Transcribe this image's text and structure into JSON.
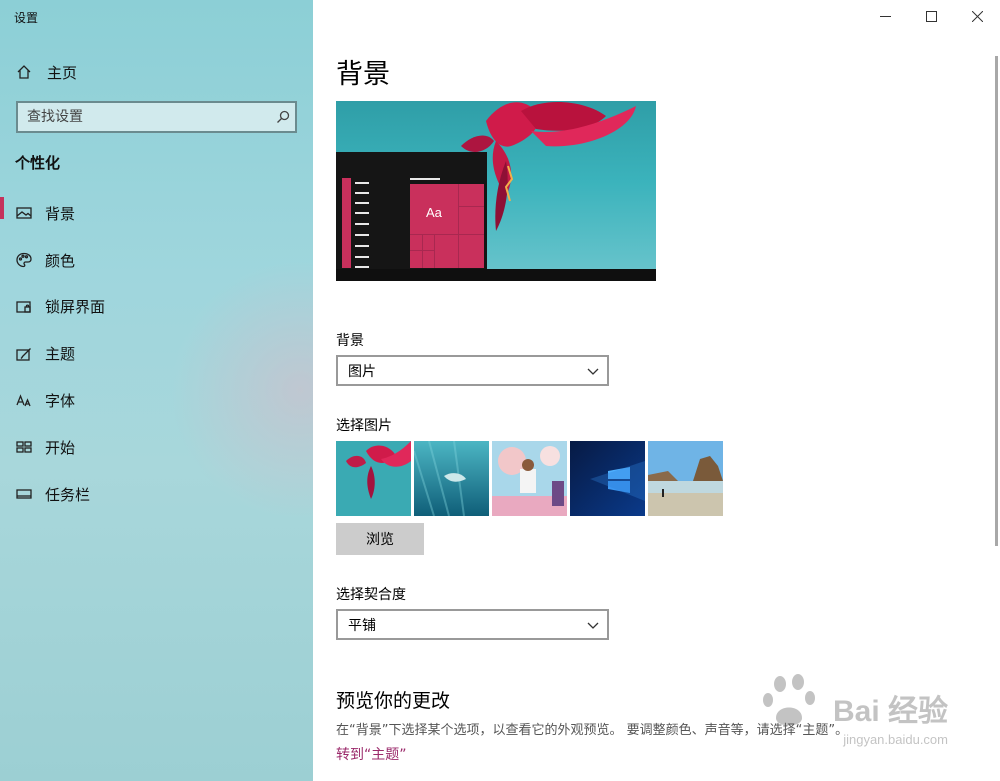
{
  "window": {
    "title": "设置"
  },
  "sidebar": {
    "home_label": "主页",
    "search_placeholder": "查找设置",
    "section_heading": "个性化",
    "items": [
      {
        "label": "背景",
        "icon": "picture-icon",
        "active": true
      },
      {
        "label": "颜色",
        "icon": "palette-icon",
        "active": false
      },
      {
        "label": "锁屏界面",
        "icon": "lock-screen-icon",
        "active": false
      },
      {
        "label": "主题",
        "icon": "theme-icon",
        "active": false
      },
      {
        "label": "字体",
        "icon": "font-icon",
        "active": false
      },
      {
        "label": "开始",
        "icon": "start-icon",
        "active": false
      },
      {
        "label": "任务栏",
        "icon": "taskbar-icon",
        "active": false
      }
    ]
  },
  "main": {
    "title": "背景",
    "preview_tile_text": "Aa",
    "background_label": "背景",
    "background_value": "图片",
    "choose_picture_label": "选择图片",
    "browse_label": "浏览",
    "fit_label": "选择契合度",
    "fit_value": "平铺",
    "preview_section_title": "预览你的更改",
    "preview_desc": "在“背景”下选择某个选项，以查看它的外观预览。 要调整颜色、声音等，请选择“主题”。",
    "theme_link": "转到“主题”"
  },
  "watermark": {
    "text": "Bai 经验",
    "sub": "jingyan.baidu.com"
  },
  "colors": {
    "accent": "#c5325c",
    "link": "#9b2a6b",
    "sidebar_bg": "#9fd6dd"
  }
}
